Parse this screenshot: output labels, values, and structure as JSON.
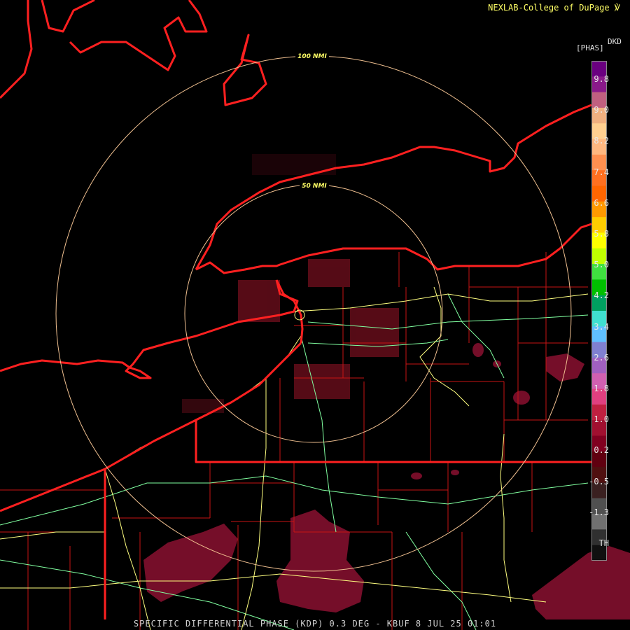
{
  "header": {
    "credit": "NEXLAB-College of DuPage"
  },
  "map": {
    "range_rings": [
      {
        "label": "100 NMI"
      },
      {
        "label": "50 NMI"
      }
    ],
    "colors": {
      "background": "#000000",
      "boundaries": "#ff2020",
      "county_lines": "#c81414",
      "range_rings": "#f0c090",
      "ring_labels": "#ffff66",
      "highways_yellow": "#ffff80",
      "highways_green": "#80ffa0",
      "echo": "#8a1030"
    }
  },
  "legend": {
    "product": "DKD",
    "unit": "[PHAS]",
    "labels": [
      "9.8",
      "9.0",
      "8.2",
      "7.4",
      "6.6",
      "5.8",
      "5.0",
      "4.2",
      "3.4",
      "2.6",
      "1.8",
      "1.0",
      "0.2",
      "-0.5",
      "-1.3",
      "TH"
    ],
    "colors": [
      "#6a0080",
      "#8a1a8a",
      "#c06080",
      "#f0b080",
      "#ffd090",
      "#ffb880",
      "#ff9050",
      "#ff7020",
      "#ff6600",
      "#ff9900",
      "#ffcc00",
      "#ffff00",
      "#c0ff00",
      "#40e040",
      "#00c000",
      "#00a060",
      "#40e0d0",
      "#60c0ff",
      "#8080d0",
      "#a060c0",
      "#d060b0",
      "#e04080",
      "#c02040",
      "#a01030",
      "#800020",
      "#600010",
      "#501010",
      "#3a2020",
      "#505050",
      "#707070",
      "#303030",
      "#101010"
    ]
  },
  "footer": {
    "title": "SPECIFIC DIFFERENTIAL PHASE (KDP) 0.3 DEG - KBUF 8 JUL 25 01:01"
  }
}
